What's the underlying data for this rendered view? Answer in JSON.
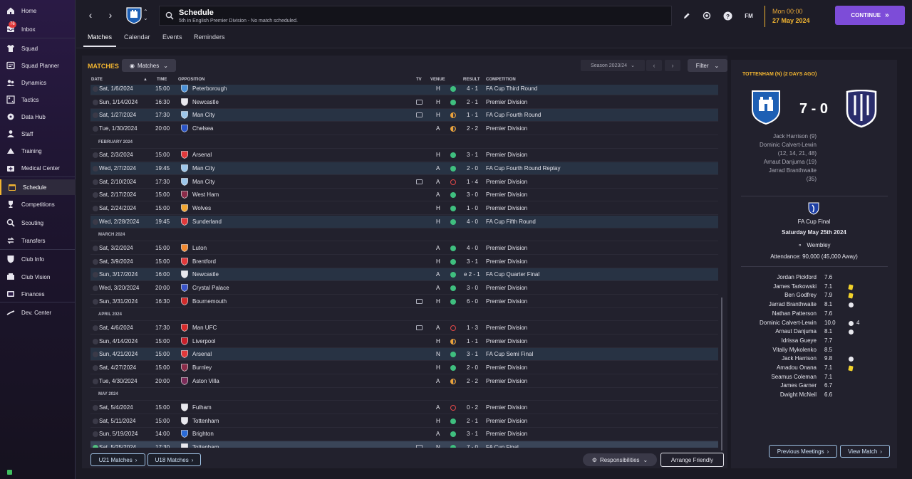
{
  "sidebar": {
    "inbox_badge": "76",
    "items": [
      {
        "label": "Home",
        "icon": "home-icon"
      },
      {
        "label": "Inbox",
        "icon": "inbox-icon"
      },
      {
        "label": "Squad",
        "icon": "shirt-icon"
      },
      {
        "label": "Squad Planner",
        "icon": "planner-icon"
      },
      {
        "label": "Dynamics",
        "icon": "dynamics-icon"
      },
      {
        "label": "Tactics",
        "icon": "tactics-icon"
      },
      {
        "label": "Data Hub",
        "icon": "datahub-icon"
      },
      {
        "label": "Staff",
        "icon": "staff-icon"
      },
      {
        "label": "Training",
        "icon": "training-icon"
      },
      {
        "label": "Medical Center",
        "icon": "medical-icon"
      },
      {
        "label": "Schedule",
        "icon": "calendar-icon"
      },
      {
        "label": "Competitions",
        "icon": "trophy-icon"
      },
      {
        "label": "Scouting",
        "icon": "scouting-icon"
      },
      {
        "label": "Transfers",
        "icon": "transfers-icon"
      },
      {
        "label": "Club Info",
        "icon": "shield-icon"
      },
      {
        "label": "Club Vision",
        "icon": "vision-icon"
      },
      {
        "label": "Finances",
        "icon": "finances-icon"
      },
      {
        "label": "Dev. Center",
        "icon": "devcenter-icon"
      }
    ]
  },
  "header": {
    "title": "Schedule",
    "subtitle": "5th in English Premier Division - No match scheduled.",
    "fm_label": "FM",
    "date_line1": "Mon 00:00",
    "date_line2": "27 May 2024",
    "continue_label": "CONTINUE"
  },
  "tabs": [
    "Matches",
    "Calendar",
    "Events",
    "Reminders"
  ],
  "main": {
    "section_title": "MATCHES",
    "view_dropdown": "Matches",
    "season": "Season 2023/24",
    "filter_label": "Filter",
    "columns": {
      "date": "DATE",
      "time": "TIME",
      "opposition": "OPPOSITION",
      "tv": "TV",
      "venue": "VENUE",
      "result": "RESULT",
      "competition": "COMPETITION"
    },
    "months": {
      "feb": "FEBRUARY 2024",
      "mar": "MARCH 2024",
      "apr": "APRIL 2024",
      "may": "MAY 2024"
    },
    "rows": [
      {
        "date": "Sat, 1/6/2024",
        "time": "15:00",
        "opp": "Peterborough",
        "tv": false,
        "venue": "H",
        "res": "4 - 1",
        "outcome": "w",
        "comp": "FA Cup Third Round",
        "hl": true
      },
      {
        "date": "Sun, 1/14/2024",
        "time": "16:30",
        "opp": "Newcastle",
        "tv": true,
        "venue": "H",
        "res": "2 - 1",
        "outcome": "w",
        "comp": "Premier Division",
        "hl": false
      },
      {
        "date": "Sat, 1/27/2024",
        "time": "17:30",
        "opp": "Man City",
        "tv": true,
        "venue": "H",
        "res": "1 - 1",
        "outcome": "d",
        "comp": "FA Cup Fourth Round",
        "hl": true
      },
      {
        "date": "Tue, 1/30/2024",
        "time": "20:00",
        "opp": "Chelsea",
        "tv": false,
        "venue": "A",
        "res": "2 - 2",
        "outcome": "d",
        "comp": "Premier Division",
        "hl": false
      },
      {
        "date": "Sat, 2/3/2024",
        "time": "15:00",
        "opp": "Arsenal",
        "tv": false,
        "venue": "H",
        "res": "3 - 1",
        "outcome": "w",
        "comp": "Premier Division",
        "hl": false
      },
      {
        "date": "Wed, 2/7/2024",
        "time": "19:45",
        "opp": "Man City",
        "tv": false,
        "venue": "A",
        "res": "2 - 0",
        "outcome": "w",
        "comp": "FA Cup Fourth Round Replay",
        "hl": true
      },
      {
        "date": "Sat, 2/10/2024",
        "time": "17:30",
        "opp": "Man City",
        "tv": true,
        "venue": "A",
        "res": "1 - 4",
        "outcome": "l",
        "comp": "Premier Division",
        "hl": false
      },
      {
        "date": "Sat, 2/17/2024",
        "time": "15:00",
        "opp": "West Ham",
        "tv": false,
        "venue": "A",
        "res": "3 - 0",
        "outcome": "w",
        "comp": "Premier Division",
        "hl": false
      },
      {
        "date": "Sat, 2/24/2024",
        "time": "15:00",
        "opp": "Wolves",
        "tv": false,
        "venue": "H",
        "res": "1 - 0",
        "outcome": "w",
        "comp": "Premier Division",
        "hl": false
      },
      {
        "date": "Wed, 2/28/2024",
        "time": "19:45",
        "opp": "Sunderland",
        "tv": false,
        "venue": "H",
        "res": "4 - 0",
        "outcome": "w",
        "comp": "FA Cup Fifth Round",
        "hl": true
      },
      {
        "date": "Sat, 3/2/2024",
        "time": "15:00",
        "opp": "Luton",
        "tv": false,
        "venue": "A",
        "res": "4 - 0",
        "outcome": "w",
        "comp": "Premier Division",
        "hl": false
      },
      {
        "date": "Sat, 3/9/2024",
        "time": "15:00",
        "opp": "Brentford",
        "tv": false,
        "venue": "H",
        "res": "3 - 1",
        "outcome": "w",
        "comp": "Premier Division",
        "hl": false
      },
      {
        "date": "Sun, 3/17/2024",
        "time": "16:00",
        "opp": "Newcastle",
        "tv": false,
        "venue": "A",
        "res": "e 2 - 1",
        "outcome": "w",
        "comp": "FA Cup Quarter Final",
        "hl": true
      },
      {
        "date": "Wed, 3/20/2024",
        "time": "20:00",
        "opp": "Crystal Palace",
        "tv": false,
        "venue": "A",
        "res": "3 - 0",
        "outcome": "w",
        "comp": "Premier Division",
        "hl": false
      },
      {
        "date": "Sun, 3/31/2024",
        "time": "16:30",
        "opp": "Bournemouth",
        "tv": true,
        "venue": "H",
        "res": "6 - 0",
        "outcome": "w",
        "comp": "Premier Division",
        "hl": false
      },
      {
        "date": "Sat, 4/6/2024",
        "time": "17:30",
        "opp": "Man UFC",
        "tv": true,
        "venue": "A",
        "res": "1 - 3",
        "outcome": "l",
        "comp": "Premier Division",
        "hl": false
      },
      {
        "date": "Sun, 4/14/2024",
        "time": "15:00",
        "opp": "Liverpool",
        "tv": false,
        "venue": "H",
        "res": "1 - 1",
        "outcome": "d",
        "comp": "Premier Division",
        "hl": false
      },
      {
        "date": "Sun, 4/21/2024",
        "time": "15:00",
        "opp": "Arsenal",
        "tv": false,
        "venue": "N",
        "res": "3 - 1",
        "outcome": "w",
        "comp": "FA Cup Semi Final",
        "hl": true
      },
      {
        "date": "Sat, 4/27/2024",
        "time": "15:00",
        "opp": "Burnley",
        "tv": false,
        "venue": "H",
        "res": "2 - 0",
        "outcome": "w",
        "comp": "Premier Division",
        "hl": false
      },
      {
        "date": "Tue, 4/30/2024",
        "time": "20:00",
        "opp": "Aston Villa",
        "tv": false,
        "venue": "A",
        "res": "2 - 2",
        "outcome": "d",
        "comp": "Premier Division",
        "hl": false
      },
      {
        "date": "Sat, 5/4/2024",
        "time": "15:00",
        "opp": "Fulham",
        "tv": false,
        "venue": "A",
        "res": "0 - 2",
        "outcome": "l",
        "comp": "Premier Division",
        "hl": false
      },
      {
        "date": "Sat, 5/11/2024",
        "time": "15:00",
        "opp": "Tottenham",
        "tv": false,
        "venue": "H",
        "res": "2 - 1",
        "outcome": "w",
        "comp": "Premier Division",
        "hl": false
      },
      {
        "date": "Sun, 5/19/2024",
        "time": "14:00",
        "opp": "Brighton",
        "tv": false,
        "venue": "A",
        "res": "3 - 1",
        "outcome": "w",
        "comp": "Premier Division",
        "hl": false
      },
      {
        "date": "Sat, 5/25/2024",
        "time": "17:30",
        "opp": "Tottenham",
        "tv": true,
        "venue": "N",
        "res": "7 - 0",
        "outcome": "w",
        "comp": "FA Cup Final",
        "hl": true
      }
    ],
    "u21_label": "U21 Matches",
    "u18_label": "U18 Matches",
    "responsibilities_label": "Responsibilities",
    "friendly_label": "Arrange Friendly"
  },
  "match_panel": {
    "heading": "TOTTENHAM (N) (2 DAYS AGO)",
    "score": "7 - 0",
    "scorers": [
      "Jack Harrison (9)",
      "Dominic Calvert-Lewin",
      "(12, 14, 21, 48)",
      "Arnaut Danjuma (19)",
      "Jarrad Branthwaite",
      "(35)"
    ],
    "competition": "FA Cup Final",
    "date": "Saturday May 25th 2024",
    "stadium": "Wembley",
    "attendance": "Attendance: 90,000 (45,000 Away)",
    "lineup": [
      {
        "name": "Jordan Pickford",
        "rating": "7.6"
      },
      {
        "name": "James Tarkowski",
        "rating": "7.1",
        "yellow": true
      },
      {
        "name": "Ben Godfrey",
        "rating": "7.9",
        "yellow": true
      },
      {
        "name": "Jarrad Branthwaite",
        "rating": "8.1",
        "goals": 1
      },
      {
        "name": "Nathan Patterson",
        "rating": "7.6"
      },
      {
        "name": "Dominic Calvert-Lewin",
        "rating": "10.0",
        "goals": 4,
        "goal_count": "4"
      },
      {
        "name": "Arnaut Danjuma",
        "rating": "8.1",
        "goals": 1
      },
      {
        "name": "Idrissa Gueye",
        "rating": "7.7"
      },
      {
        "name": "Vitaliy Mykolenko",
        "rating": "8.5"
      },
      {
        "name": "Jack Harrison",
        "rating": "9.8",
        "goals": 1
      },
      {
        "name": "Amadou Onana",
        "rating": "7.1",
        "yellow": true
      },
      {
        "name": "Seamus Coleman",
        "rating": "7.1"
      },
      {
        "name": "James Garner",
        "rating": "6.7"
      },
      {
        "name": "Dwight McNeil",
        "rating": "6.6"
      }
    ],
    "prev_label": "Previous Meetings",
    "view_label": "View Match"
  },
  "colors": {
    "accent": "#f2b531",
    "continue": "#7d4cd8",
    "win": "#3fbf7f",
    "draw": "#e9a23b",
    "loss": "#e34848"
  }
}
